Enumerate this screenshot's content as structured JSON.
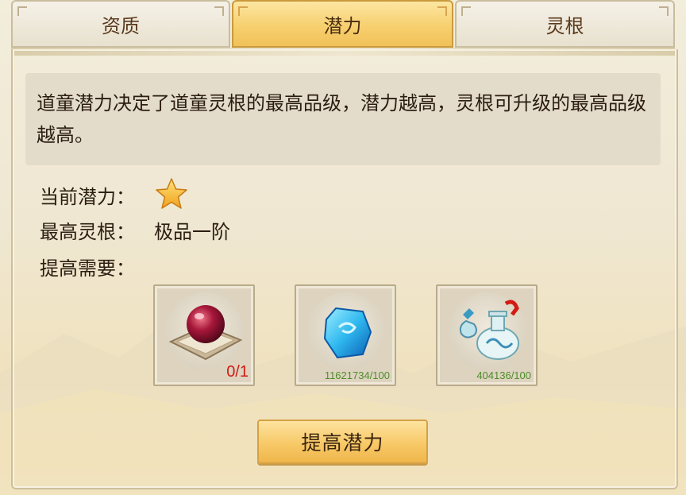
{
  "tabs": [
    {
      "label": "资质",
      "active": false
    },
    {
      "label": "潜力",
      "active": true
    },
    {
      "label": "灵根",
      "active": false
    }
  ],
  "description": "道童潜力决定了道童灵根的最高品级，潜力越高，灵根可升级的最高品级越高。",
  "info": {
    "current_potential_label": "当前潜力：",
    "current_potential_stars": 1,
    "max_root_label": "最高灵根：",
    "max_root_value": "极品一阶",
    "requirement_label": "提高需要："
  },
  "requirements": [
    {
      "icon": "red-orb-icon",
      "count": "0/1",
      "count_color": "#d21b14"
    },
    {
      "icon": "blue-crystal-icon",
      "count": "11621734/100",
      "count_color": "#4f8d2b"
    },
    {
      "icon": "potion-bottle-icon",
      "count": "404136/100",
      "count_color": "#4f8d2b"
    }
  ],
  "action_button": "提高潜力"
}
